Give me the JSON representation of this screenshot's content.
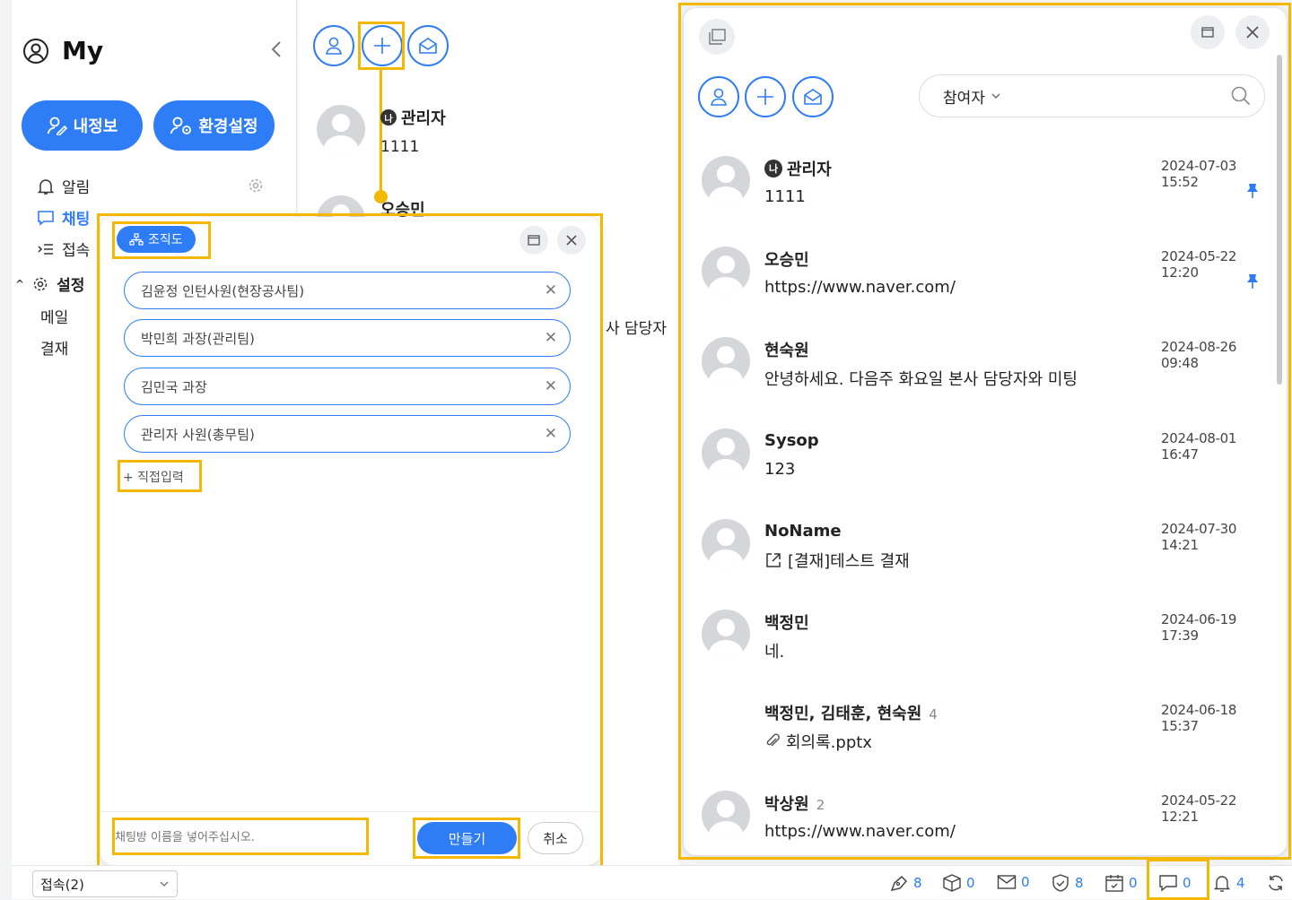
{
  "left": {
    "title": "My",
    "btn_profile": "내정보",
    "btn_settings": "환경설정",
    "menu": {
      "alarm": "알림",
      "chat": "채팅",
      "access": "접속",
      "settings": "설정",
      "mail": "메일",
      "approval": "결재"
    }
  },
  "middle": {
    "items": [
      {
        "badge": "나",
        "name": "관리자",
        "msg": "1111"
      },
      {
        "name": "오승민"
      }
    ],
    "partial_text": "사 담당자"
  },
  "dialog": {
    "org_button": "조직도",
    "chips": [
      "김윤정 인턴사원(현장공사팀)",
      "박민희 과장(관리팀)",
      "김민국 과장",
      "관리자 사원(총무팀)"
    ],
    "direct_input": "+ 직접입력",
    "room_name_placeholder": "채팅방 이름을 넣어주십시오.",
    "create_button": "만들기",
    "cancel_button": "취소"
  },
  "right": {
    "filter_label": "참여자",
    "conversations": [
      {
        "badge": "나",
        "name": "관리자",
        "msg": "1111",
        "time": "2024-07-03 15:52",
        "pinned": true,
        "avatar": true
      },
      {
        "name": "오승민",
        "msg": "https://www.naver.com/",
        "time": "2024-05-22 12:20",
        "pinned": true,
        "avatar": true
      },
      {
        "name": "현숙원",
        "msg": "안녕하세요. 다음주 화요일 본사 담당자와 미팅",
        "time": "2024-08-26 09:48",
        "avatar": true
      },
      {
        "name": "Sysop",
        "msg": "123",
        "time": "2024-08-01 16:47",
        "avatar": true
      },
      {
        "name": "NoName",
        "msg": "[결재]테스트 결재",
        "time": "2024-07-30 14:21",
        "avatar": true,
        "msg_icon": "external-link-icon"
      },
      {
        "name": "백정민",
        "msg": "네.",
        "time": "2024-06-19 17:39",
        "avatar": true
      },
      {
        "name": "백정민, 김태훈, 현숙원",
        "count": "4",
        "msg": "회의록.pptx",
        "time": "2024-06-18 15:37",
        "avatar": false,
        "msg_icon": "paperclip-icon"
      },
      {
        "name": "박상원",
        "count": "2",
        "msg": "https://www.naver.com/",
        "time": "2024-05-22 12:21",
        "avatar": true
      }
    ]
  },
  "status": {
    "connection_select": "접속(2)",
    "counters": {
      "pen": "8",
      "box": "0",
      "mail": "0",
      "shield": "8",
      "calendar": "0",
      "chat": "0",
      "bell": "4"
    }
  },
  "colors": {
    "accent": "#2e7cf6",
    "highlight": "#f5b800"
  }
}
